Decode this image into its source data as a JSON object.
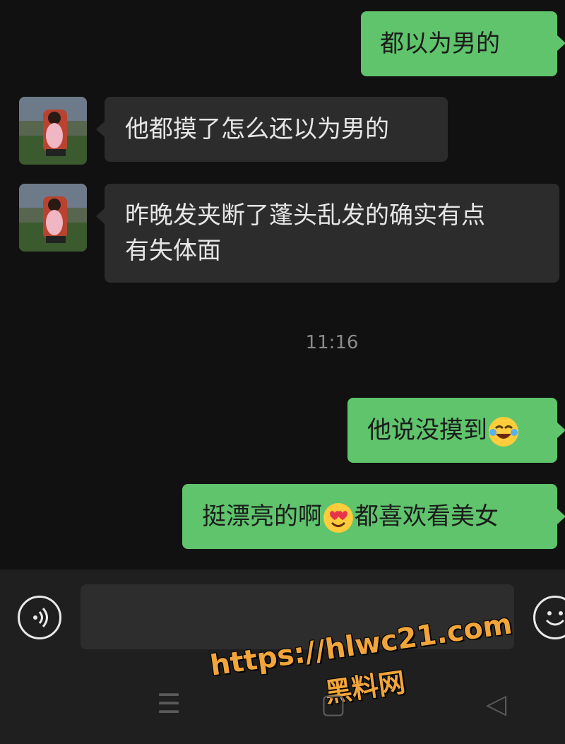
{
  "messages": [
    {
      "side": "out",
      "text": "都以为男的"
    },
    {
      "side": "in",
      "text": "他都摸了怎么还以为男的"
    },
    {
      "side": "in",
      "line1": "昨晚发夹断了蓬头乱发的确实有点",
      "line2": "有失体面"
    },
    {
      "side": "out",
      "text_before_emoji": "他说没摸到",
      "emoji": "laughing-crying-emoji"
    },
    {
      "side": "out",
      "text_before_emoji": "挺漂亮的啊",
      "emoji": "heart-eyes-emoji",
      "text_after_emoji": "都喜欢看美女"
    }
  ],
  "timestamp": "11:16",
  "input_bar": {
    "placeholder": "",
    "voice_icon": "voice-icon",
    "emoji_icon": "emoji-icon"
  },
  "watermark": {
    "line1": "https://hlwc21.com",
    "line2": "黑料网"
  },
  "nav": {
    "menu": "☰",
    "home": "▢",
    "back": "◁"
  },
  "colors": {
    "outgoing": "#5fc46c",
    "incoming": "#2c2c2c",
    "background": "#111111"
  }
}
